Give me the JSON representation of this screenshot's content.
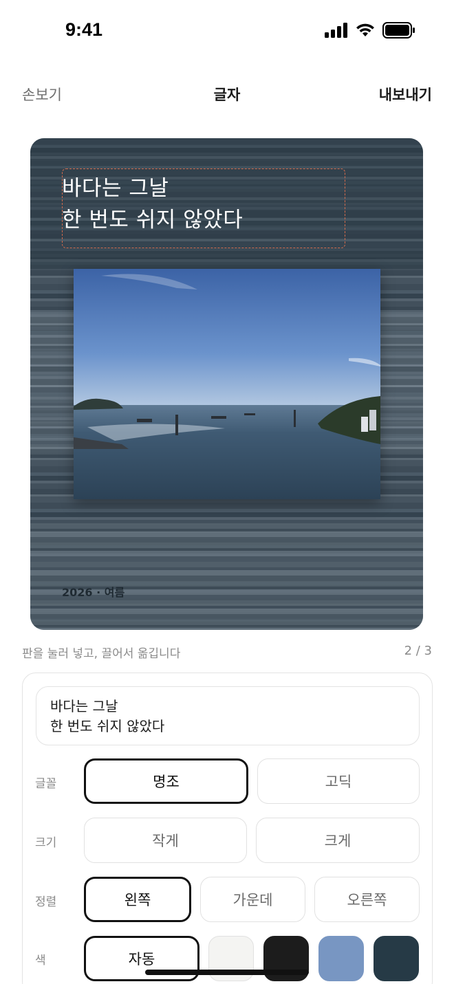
{
  "status_bar": {
    "time": "9:41",
    "icons": [
      "signal-icon",
      "wifi-icon",
      "battery-icon"
    ]
  },
  "nav": {
    "left_label": "손보기",
    "title": "글자",
    "right_label": "내보내기"
  },
  "canvas": {
    "title_text": "바다는 그날\n한 번도 쉬지 않았다",
    "caption": "2026 · 여름",
    "photo_description_icon": "photo-seaside"
  },
  "hint_text": "판을 눌러 넣고, 끌어서 옮깁니다",
  "page_indicator": "2 / 3",
  "editor": {
    "text_value": "바다는 그날\n한 번도 쉬지 않았다",
    "font": {
      "label": "글꼴",
      "options": [
        "명조",
        "고딕"
      ],
      "selected": "명조"
    },
    "size": {
      "label": "크기",
      "options": [
        "작게",
        "크게"
      ]
    },
    "align": {
      "label": "정렬",
      "options": [
        "왼쪽",
        "가운데",
        "오른쪽"
      ],
      "selected": "왼쪽"
    },
    "color": {
      "label": "색",
      "auto_label": "자동",
      "swatches": [
        "#f4f4f2",
        "#1c1c1c",
        "#7896c2",
        "#263a46"
      ]
    }
  },
  "colors": {
    "accent_frame": "#d06a4c",
    "selected_border": "#111111"
  }
}
